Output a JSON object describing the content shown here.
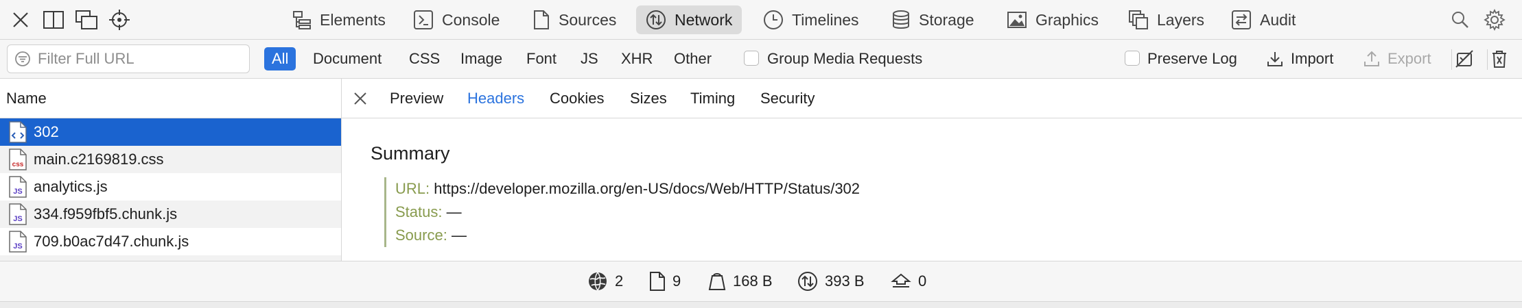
{
  "toolbar": {
    "tabs": [
      {
        "label": "Elements",
        "icon": "elements-icon"
      },
      {
        "label": "Console",
        "icon": "console-icon"
      },
      {
        "label": "Sources",
        "icon": "sources-icon"
      },
      {
        "label": "Network",
        "icon": "network-icon",
        "active": true
      },
      {
        "label": "Timelines",
        "icon": "timelines-icon"
      },
      {
        "label": "Storage",
        "icon": "storage-icon"
      },
      {
        "label": "Graphics",
        "icon": "graphics-icon"
      },
      {
        "label": "Layers",
        "icon": "layers-icon"
      },
      {
        "label": "Audit",
        "icon": "audit-icon"
      }
    ]
  },
  "filter": {
    "placeholder": "Filter Full URL",
    "types": [
      "All",
      "Document",
      "CSS",
      "Image",
      "Font",
      "JS",
      "XHR",
      "Other"
    ],
    "active_type": "All",
    "group_media_label": "Group Media Requests",
    "preserve_log_label": "Preserve Log",
    "import_label": "Import",
    "export_label": "Export"
  },
  "list": {
    "header": "Name",
    "rows": [
      {
        "name": "302",
        "kind": "doc",
        "selected": true
      },
      {
        "name": "main.c2169819.css",
        "kind": "css"
      },
      {
        "name": "analytics.js",
        "kind": "js"
      },
      {
        "name": "334.f959fbf5.chunk.js",
        "kind": "js"
      },
      {
        "name": "709.b0ac7d47.chunk.js",
        "kind": "js"
      }
    ]
  },
  "details": {
    "tabs": [
      "Preview",
      "Headers",
      "Cookies",
      "Sizes",
      "Timing",
      "Security"
    ],
    "active_tab": "Headers",
    "summary_title": "Summary",
    "fields": [
      {
        "key": "URL:",
        "value": "https://developer.mozilla.org/en-US/docs/Web/HTTP/Status/302"
      },
      {
        "key": "Status:",
        "value": "—"
      },
      {
        "key": "Source:",
        "value": "—"
      }
    ]
  },
  "status": {
    "requests": "2",
    "resources": "9",
    "transferred": "168 B",
    "size": "393 B",
    "time": "0"
  },
  "colors": {
    "accent": "#2b73de",
    "selection": "#1a63cf",
    "summary_key": "#889b4e",
    "summary_bar": "#a8b68a"
  }
}
